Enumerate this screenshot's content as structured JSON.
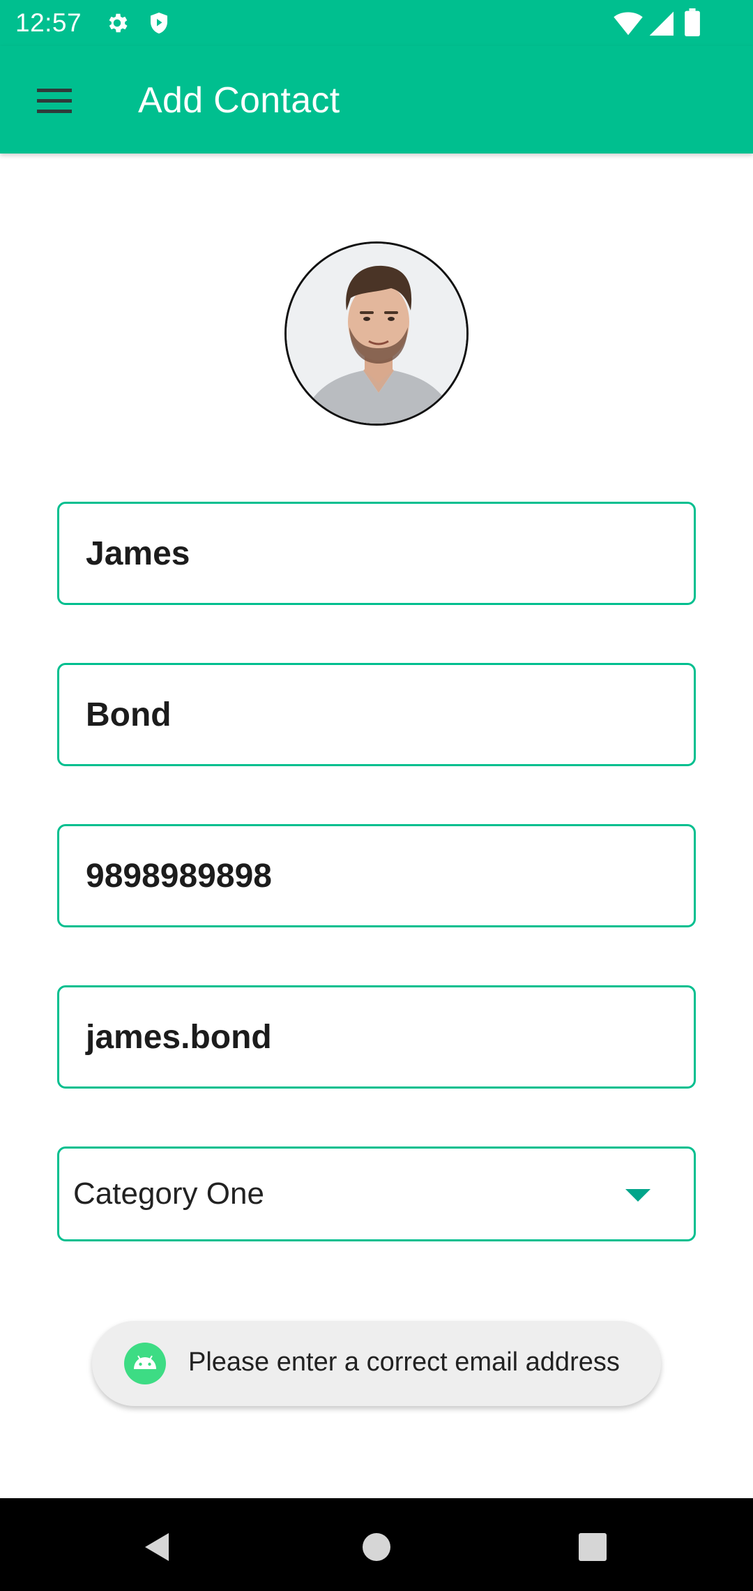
{
  "status_bar": {
    "time": "12:57",
    "icons": [
      "gear-icon",
      "shield-icon",
      "wifi-icon",
      "signal-icon",
      "battery-icon"
    ]
  },
  "app_bar": {
    "title": "Add Contact",
    "menu_icon": "hamburger-menu-icon",
    "background": "#00BF8F"
  },
  "form": {
    "first_name": "James",
    "last_name": "Bond",
    "phone": "9898989898",
    "email": "james.bond",
    "category": {
      "selected": "Category One"
    }
  },
  "toast": {
    "icon": "android-icon",
    "message": "Please enter a correct email address"
  },
  "navigation": {
    "back": "back-icon",
    "home": "home-icon",
    "recents": "recents-icon"
  },
  "colors": {
    "accent": "#00BF8F",
    "field_border": "#00BF8F",
    "nav_background": "#000000",
    "toast_background": "#EEEEEE"
  }
}
